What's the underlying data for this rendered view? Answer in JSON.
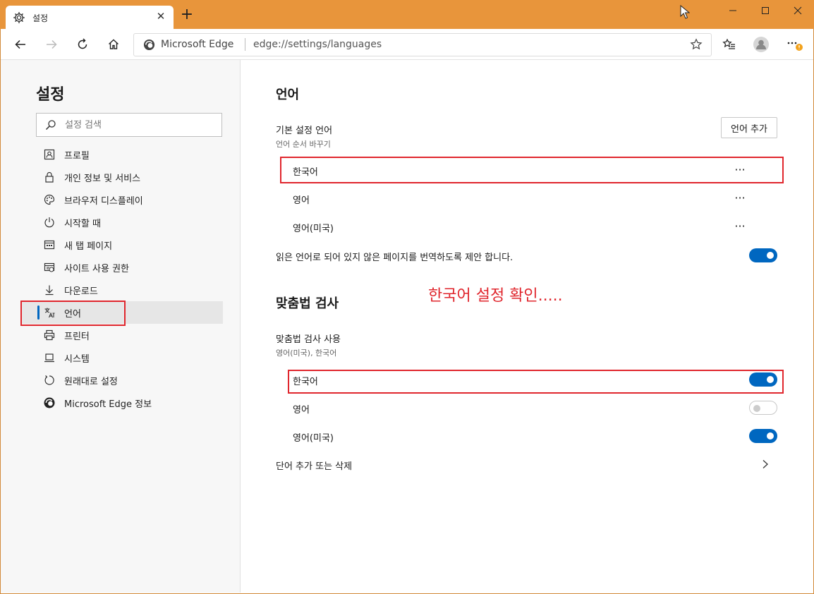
{
  "tab": {
    "title": "설정",
    "close": "✕",
    "new_tab": "+"
  },
  "address_bar": {
    "site": "Microsoft Edge",
    "url": "edge://settings/languages"
  },
  "sidebar": {
    "title": "설정",
    "search_placeholder": "설정 검색",
    "items": [
      {
        "label": "프로필",
        "icon": "profile-icon"
      },
      {
        "label": "개인 정보 및 서비스",
        "icon": "lock-icon"
      },
      {
        "label": "브라우저 디스플레이",
        "icon": "palette-icon"
      },
      {
        "label": "시작할 때",
        "icon": "power-icon"
      },
      {
        "label": "새 탭 페이지",
        "icon": "new-tab-page-icon"
      },
      {
        "label": "사이트 사용 권한",
        "icon": "site-permissions-icon"
      },
      {
        "label": "다운로드",
        "icon": "download-icon"
      },
      {
        "label": "언어",
        "icon": "language-icon",
        "active": true
      },
      {
        "label": "프린터",
        "icon": "printer-icon"
      },
      {
        "label": "시스템",
        "icon": "laptop-icon"
      },
      {
        "label": "원래대로 설정",
        "icon": "reset-icon"
      },
      {
        "label": "Microsoft Edge 정보",
        "icon": "edge-logo-icon"
      }
    ]
  },
  "languages": {
    "heading": "언어",
    "preferred_title": "기본 설정 언어",
    "preferred_subtitle": "언어 순서 바꾸기",
    "add_button": "언어 추가",
    "list": [
      "한국어",
      "영어",
      "영어(미국)"
    ],
    "more_label": "···",
    "offer_translate_label": "읽은 언어로 되어 있지 않은 페이지를 번역하도록 제안 합니다.",
    "offer_translate_on": true
  },
  "annotation": "한국어 설정 확인.....",
  "spellcheck": {
    "heading": "맞춤법 검사",
    "enable_title": "맞춤법 검사 사용",
    "enable_subtitle": "영어(미국), 한국어",
    "list": [
      {
        "label": "한국어",
        "on": true
      },
      {
        "label": "영어",
        "on": false
      },
      {
        "label": "영어(미국)",
        "on": true
      }
    ],
    "custom_words_label": "단어 추가 또는 삭제"
  },
  "colors": {
    "accent": "#0067c0",
    "titlebar": "#e8953b",
    "highlight": "#e0262d"
  }
}
